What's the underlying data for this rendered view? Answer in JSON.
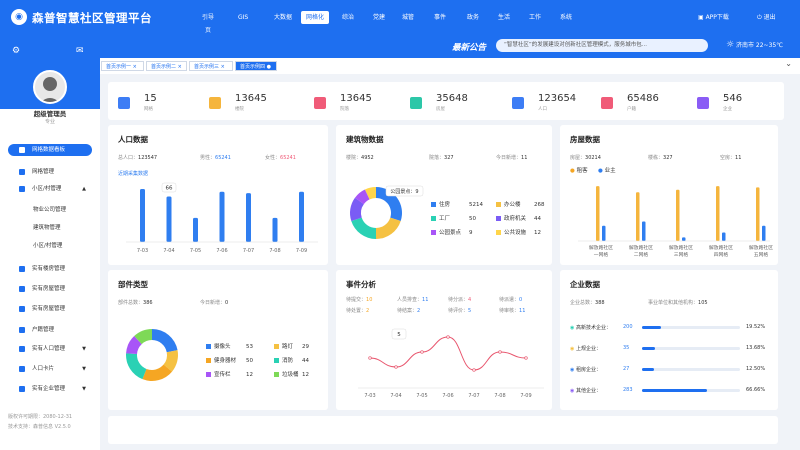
{
  "app_title": "森普智慧社区管理平台",
  "nav": [
    "引导页",
    "GIS",
    "大数据",
    "网格化",
    "综治",
    "党建",
    "城管",
    "事件",
    "政务",
    "生活",
    "工作",
    "系统"
  ],
  "nav_active": 3,
  "header": {
    "app_download": "APP下载",
    "logout": "退出",
    "notice_title": "最新公告",
    "notice_text": "“智慧社区”的发展建设对创新社区管理模式，服务城市包...",
    "weather": "济南市 22~35℃"
  },
  "sidebar": {
    "user_name": "超级管理员",
    "user_role": "专业",
    "items": [
      {
        "label": "网格数据看板",
        "active": true
      },
      {
        "label": "网格管理"
      },
      {
        "label": "小区/村管理",
        "chev": "▲"
      },
      {
        "label": "物业公司管理",
        "sub": true
      },
      {
        "label": "建筑物管理",
        "sub": true
      },
      {
        "label": "小区/村管理",
        "sub": true
      },
      {
        "label": "实有楼房管理"
      },
      {
        "label": "实有房屋管理"
      },
      {
        "label": "实有房屋管理"
      },
      {
        "label": "户籍管理"
      },
      {
        "label": "实有人口管理",
        "chev": "▼"
      },
      {
        "label": "人口卡片",
        "chev": "▼"
      },
      {
        "label": "实有企业管理",
        "chev": "▼"
      }
    ],
    "foot_line1": "版权许可期限：2080-12-31",
    "foot_line2": "技术支持：森普信息  V2.5.0"
  },
  "tabs": [
    {
      "label": "首页示例一 ×"
    },
    {
      "label": "首页示例二 ×"
    },
    {
      "label": "首页示例三 ×"
    },
    {
      "label": "首页示例四 ●",
      "active": true
    }
  ],
  "stats": [
    {
      "value": "15",
      "label": "网格",
      "color": "#3d7df5"
    },
    {
      "value": "13645",
      "label": "楼院",
      "color": "#f5b53d"
    },
    {
      "value": "13645",
      "label": "院落",
      "color": "#f05b78"
    },
    {
      "value": "35648",
      "label": "房屋",
      "color": "#2cc7a8"
    },
    {
      "value": "123654",
      "label": "人口",
      "color": "#3d7df5"
    },
    {
      "value": "65486",
      "label": "户籍",
      "color": "#f05b78"
    },
    {
      "value": "546",
      "label": "企业",
      "color": "#8a5cf5"
    }
  ],
  "population": {
    "title": "人口数据",
    "total_label": "总人口：",
    "total": "123547",
    "male_label": "男性：",
    "male": "65241",
    "female_label": "女性：",
    "female": "65241",
    "link": "近期采集数据",
    "tooltip": "66"
  },
  "buildings": {
    "title": "建筑物数据",
    "total_label": "楼院：",
    "total": "4952",
    "yard_label": "院落：",
    "yard": "327",
    "today_label": "今日新增：",
    "today": "11",
    "tooltip": "公园景点：9",
    "legend": [
      {
        "label": "住房",
        "value": "5214",
        "color": "#2f7ef0"
      },
      {
        "label": "办公楼",
        "value": "268",
        "color": "#f5c142"
      },
      {
        "label": "工厂",
        "value": "50",
        "color": "#2ad1b4"
      },
      {
        "label": "政府机关",
        "value": "44",
        "color": "#7a5cf5"
      },
      {
        "label": "公园景点",
        "value": "9",
        "color": "#a855f7"
      },
      {
        "label": "公共设施",
        "value": "12",
        "color": "#ffd54a"
      }
    ]
  },
  "housing": {
    "title": "房屋数据",
    "total_label": "房屋：",
    "total": "30214",
    "rent_label": "楼栋：",
    "rent": "327",
    "empty_label": "空房：",
    "empty": "11",
    "series_names": [
      "租客",
      "业主"
    ]
  },
  "components": {
    "title": "部件类型",
    "total_label": "部件总数：",
    "total": "386",
    "today_label": "今日新增：",
    "today": "0",
    "legend": [
      {
        "label": "摄像头",
        "value": "53",
        "color": "#2f7ef0"
      },
      {
        "label": "路灯",
        "value": "29",
        "color": "#f5c142"
      },
      {
        "label": "健身器材",
        "value": "50",
        "color": "#f5a623"
      },
      {
        "label": "消防",
        "value": "44",
        "color": "#2ad1b4"
      },
      {
        "label": "宣传栏",
        "value": "12",
        "color": "#a855f7"
      },
      {
        "label": "垃圾桶",
        "value": "12",
        "color": "#7ed957"
      }
    ]
  },
  "events": {
    "title": "事件分析",
    "rows": [
      [
        {
          "label": "待提交：",
          "value": "10",
          "color": "#f5a623"
        },
        {
          "label": "人员排查：",
          "value": "11",
          "color": "#2f7ef0"
        },
        {
          "label": "待分派：",
          "value": "4",
          "color": "#f05b78"
        },
        {
          "label": "待派遣：",
          "value": "0",
          "color": "#2f7ef0"
        }
      ],
      [
        {
          "label": "待处置：",
          "value": "2",
          "color": "#f5a623"
        },
        {
          "label": "待结案：",
          "value": "2",
          "color": "#2f7ef0"
        },
        {
          "label": "待评价：",
          "value": "5",
          "color": "#2f7ef0"
        },
        {
          "label": "待审核：",
          "value": "11",
          "color": "#2f7ef0"
        }
      ]
    ],
    "tooltip": "5"
  },
  "enterprise": {
    "title": "企业数据",
    "total_label": "企业总数：",
    "total": "388",
    "units_label": "事业单位和其他机构：",
    "units": "105",
    "rows": [
      {
        "label": "高新技术企业：",
        "count": "200",
        "pct": "19.52%",
        "frac": 0.1952
      },
      {
        "label": "上规企业：",
        "count": "35",
        "pct": "13.68%",
        "frac": 0.1368
      },
      {
        "label": "租房企业：",
        "count": "27",
        "pct": "12.50%",
        "frac": 0.125
      },
      {
        "label": "其他企业：",
        "count": "283",
        "pct": "66.66%",
        "frac": 0.6666
      }
    ]
  },
  "chart_data": [
    {
      "type": "bar",
      "title": "人口数据",
      "categories": [
        "7-03",
        "7-04",
        "7-05",
        "7-06",
        "7-07",
        "7-08",
        "7-09"
      ],
      "values": [
        77,
        66,
        35,
        73,
        71,
        35,
        73
      ],
      "ylim": [
        0,
        90
      ]
    },
    {
      "type": "pie",
      "title": "建筑物数据",
      "labels": [
        "住房",
        "办公楼",
        "工厂",
        "政府机关",
        "公园景点",
        "公共设施"
      ],
      "values": [
        5214,
        268,
        50,
        44,
        9,
        12
      ]
    },
    {
      "type": "bar",
      "title": "房屋数据",
      "categories": [
        "解放路社区一网格",
        "解放路社区二网格",
        "解放路社区三网格",
        "解放路社区四网格",
        "解放路社区五网格"
      ],
      "series": [
        {
          "name": "租客",
          "values": [
            90,
            80,
            84,
            90,
            88
          ]
        },
        {
          "name": "业主",
          "values": [
            25,
            32,
            6,
            14,
            25
          ]
        }
      ],
      "ylim": [
        0,
        100
      ]
    },
    {
      "type": "pie",
      "title": "部件类型",
      "labels": [
        "摄像头",
        "路灯",
        "健身器材",
        "消防",
        "宣传栏",
        "垃圾桶"
      ],
      "values": [
        53,
        29,
        50,
        44,
        12,
        12
      ]
    },
    {
      "type": "line",
      "title": "事件分析",
      "categories": [
        "7-03",
        "7-04",
        "7-05",
        "7-06",
        "7-07",
        "7-08",
        "7-09"
      ],
      "values": [
        5,
        3.5,
        6,
        8.5,
        3,
        6,
        5
      ],
      "ylim": [
        0,
        10
      ]
    }
  ]
}
